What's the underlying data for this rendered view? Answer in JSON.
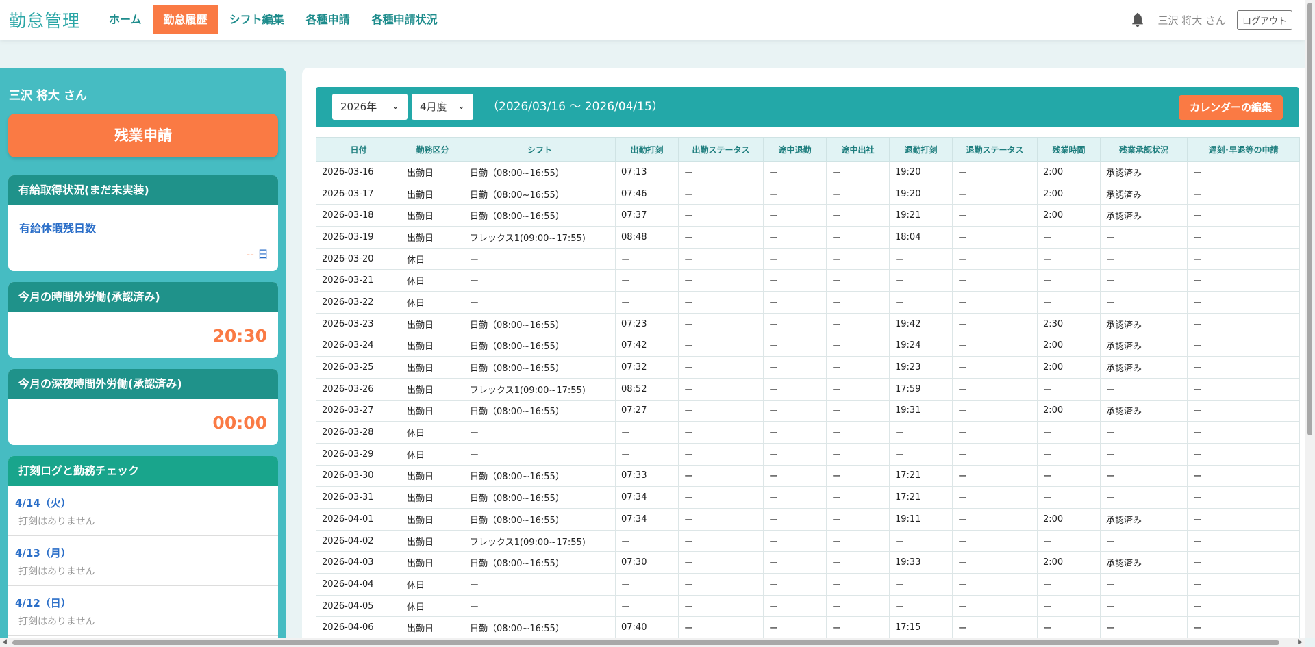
{
  "header": {
    "brand": "勤怠管理",
    "nav": [
      "ホーム",
      "勤怠履歴",
      "シフト編集",
      "各種申請",
      "各種申請状況"
    ],
    "active_index": 1,
    "user": "三沢 将大 さん",
    "logout": "ログアウト",
    "icons": {
      "notification": "bell-icon"
    }
  },
  "sidebar": {
    "user": "三沢 将大 さん",
    "overtime_button": "残業申請",
    "paid_leave": {
      "title": "有給取得状況(まだ未実装)",
      "label": "有給休暇残日数",
      "value": "--",
      "unit": "日"
    },
    "overtime_month": {
      "title": "今月の時間外労働(承認済み)",
      "value": "20:30"
    },
    "night_overtime_month": {
      "title": "今月の深夜時間外労働(承認済み)",
      "value": "00:00"
    },
    "log": {
      "title": "打刻ログと勤務チェック",
      "items": [
        {
          "date": "4/14（火）",
          "text": "打刻はありません"
        },
        {
          "date": "4/13（月）",
          "text": "打刻はありません"
        },
        {
          "date": "4/12（日）",
          "text": "打刻はありません"
        }
      ]
    }
  },
  "filter": {
    "year": "2026年",
    "month": "4月度",
    "range": "（2026/03/16 〜 2026/04/15）",
    "calendar_button": "カレンダーの編集"
  },
  "table": {
    "columns": [
      "日付",
      "勤務区分",
      "シフト",
      "出勤打刻",
      "出勤ステータス",
      "途中退勤",
      "途中出社",
      "退勤打刻",
      "退勤ステータス",
      "残業時間",
      "残業承認状況",
      "遅刻･早退等の申請"
    ],
    "rows": [
      [
        "2026-03-16",
        "出勤日",
        "日勤（08:00~16:55）",
        "07:13",
        "ー",
        "ー",
        "ー",
        "19:20",
        "ー",
        "2:00",
        "承認済み",
        "ー"
      ],
      [
        "2026-03-17",
        "出勤日",
        "日勤（08:00~16:55）",
        "07:46",
        "ー",
        "ー",
        "ー",
        "19:20",
        "ー",
        "2:00",
        "承認済み",
        "ー"
      ],
      [
        "2026-03-18",
        "出勤日",
        "日勤（08:00~16:55）",
        "07:37",
        "ー",
        "ー",
        "ー",
        "19:21",
        "ー",
        "2:00",
        "承認済み",
        "ー"
      ],
      [
        "2026-03-19",
        "出勤日",
        "フレックス1(09:00~17:55)",
        "08:48",
        "ー",
        "ー",
        "ー",
        "18:04",
        "ー",
        "ー",
        "ー",
        "ー"
      ],
      [
        "2026-03-20",
        "休日",
        "ー",
        "ー",
        "ー",
        "ー",
        "ー",
        "ー",
        "ー",
        "ー",
        "ー",
        "ー"
      ],
      [
        "2026-03-21",
        "休日",
        "ー",
        "ー",
        "ー",
        "ー",
        "ー",
        "ー",
        "ー",
        "ー",
        "ー",
        "ー"
      ],
      [
        "2026-03-22",
        "休日",
        "ー",
        "ー",
        "ー",
        "ー",
        "ー",
        "ー",
        "ー",
        "ー",
        "ー",
        "ー"
      ],
      [
        "2026-03-23",
        "出勤日",
        "日勤（08:00~16:55）",
        "07:23",
        "ー",
        "ー",
        "ー",
        "19:42",
        "ー",
        "2:30",
        "承認済み",
        "ー"
      ],
      [
        "2026-03-24",
        "出勤日",
        "日勤（08:00~16:55）",
        "07:42",
        "ー",
        "ー",
        "ー",
        "19:24",
        "ー",
        "2:00",
        "承認済み",
        "ー"
      ],
      [
        "2026-03-25",
        "出勤日",
        "日勤（08:00~16:55）",
        "07:32",
        "ー",
        "ー",
        "ー",
        "19:23",
        "ー",
        "2:00",
        "承認済み",
        "ー"
      ],
      [
        "2026-03-26",
        "出勤日",
        "フレックス1(09:00~17:55)",
        "08:52",
        "ー",
        "ー",
        "ー",
        "17:59",
        "ー",
        "ー",
        "ー",
        "ー"
      ],
      [
        "2026-03-27",
        "出勤日",
        "日勤（08:00~16:55）",
        "07:27",
        "ー",
        "ー",
        "ー",
        "19:31",
        "ー",
        "2:00",
        "承認済み",
        "ー"
      ],
      [
        "2026-03-28",
        "休日",
        "ー",
        "ー",
        "ー",
        "ー",
        "ー",
        "ー",
        "ー",
        "ー",
        "ー",
        "ー"
      ],
      [
        "2026-03-29",
        "休日",
        "ー",
        "ー",
        "ー",
        "ー",
        "ー",
        "ー",
        "ー",
        "ー",
        "ー",
        "ー"
      ],
      [
        "2026-03-30",
        "出勤日",
        "日勤（08:00~16:55）",
        "07:33",
        "ー",
        "ー",
        "ー",
        "17:21",
        "ー",
        "ー",
        "ー",
        "ー"
      ],
      [
        "2026-03-31",
        "出勤日",
        "日勤（08:00~16:55）",
        "07:34",
        "ー",
        "ー",
        "ー",
        "17:21",
        "ー",
        "ー",
        "ー",
        "ー"
      ],
      [
        "2026-04-01",
        "出勤日",
        "日勤（08:00~16:55）",
        "07:34",
        "ー",
        "ー",
        "ー",
        "19:11",
        "ー",
        "2:00",
        "承認済み",
        "ー"
      ],
      [
        "2026-04-02",
        "出勤日",
        "フレックス1(09:00~17:55)",
        "ー",
        "ー",
        "ー",
        "ー",
        "ー",
        "ー",
        "ー",
        "ー",
        "ー"
      ],
      [
        "2026-04-03",
        "出勤日",
        "日勤（08:00~16:55）",
        "07:30",
        "ー",
        "ー",
        "ー",
        "19:33",
        "ー",
        "2:00",
        "承認済み",
        "ー"
      ],
      [
        "2026-04-04",
        "休日",
        "ー",
        "ー",
        "ー",
        "ー",
        "ー",
        "ー",
        "ー",
        "ー",
        "ー",
        "ー"
      ],
      [
        "2026-04-05",
        "休日",
        "ー",
        "ー",
        "ー",
        "ー",
        "ー",
        "ー",
        "ー",
        "ー",
        "ー",
        "ー"
      ],
      [
        "2026-04-06",
        "出勤日",
        "日勤（08:00~16:55）",
        "07:40",
        "ー",
        "ー",
        "ー",
        "17:15",
        "ー",
        "ー",
        "ー",
        "ー"
      ]
    ]
  }
}
